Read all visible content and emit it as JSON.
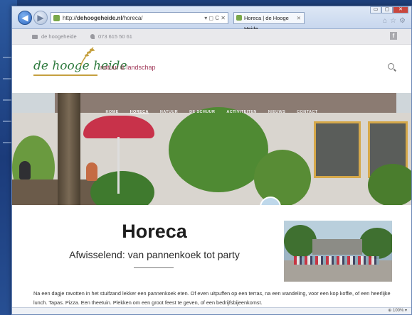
{
  "browser": {
    "url_prefix": "http://",
    "url_domain": "dehoogeheide.nl",
    "url_path": "/horeca/",
    "url_controls": "▾ ◻ C ✕",
    "tab_title": "Horeca | de Hooge Heide",
    "tab_close": "✕",
    "window_controls": [
      "▭",
      "▢",
      "✕"
    ],
    "toolbar_icons": "⌂☆⚙",
    "status_zoom": "⊕ 100% ▾"
  },
  "util_bar": {
    "brand": "de hoogeheide",
    "phone": "073 615 50 61",
    "facebook": "f"
  },
  "header": {
    "logo_text": "de hooge heide",
    "tagline": "natuur & landschap"
  },
  "nav": {
    "items": [
      "HOME",
      "HORECA",
      "NATUUR",
      "DE SCHUUR",
      "ACTIVITEITEN",
      "NIEUWS",
      "CONTACT"
    ],
    "active": "HORECA"
  },
  "page": {
    "title": "Horeca",
    "subtitle": "Afwisselend: van pannenkoek tot party",
    "paragraph": "Na een dagje ravotten in het stuifzand lekker een pannenkoek eten. Of even uitpuffen op een terras, na een wandeling, voor een kop koffie, of een heerlijke lunch. Tapas. Pizza. Een theetuin. Plekken om een groot feest te geven, of een bedrijfsbijeenkomst."
  },
  "colors": {
    "logo_green": "#2e7a3e",
    "tagline_magenta": "#a13a5a",
    "desktop_blue": "#1d3f7a"
  }
}
